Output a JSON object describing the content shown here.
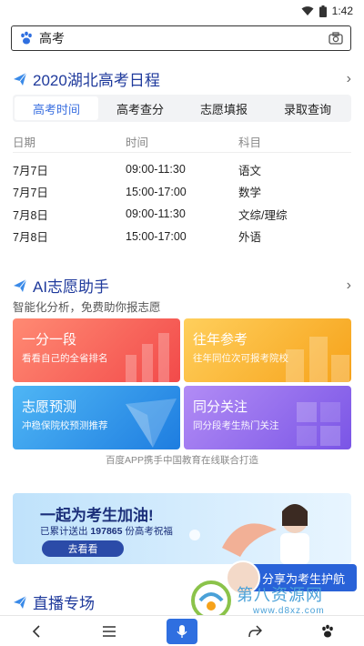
{
  "status": {
    "time": "1:42"
  },
  "search": {
    "query": "高考"
  },
  "schedule_section": {
    "title": "2020湖北高考日程",
    "tabs": [
      "高考时间",
      "高考查分",
      "志愿填报",
      "录取查询"
    ],
    "active_tab": 0,
    "headers": [
      "日期",
      "时间",
      "科目"
    ],
    "rows": [
      [
        "7月7日",
        "09:00-11:30",
        "语文"
      ],
      [
        "7月7日",
        "15:00-17:00",
        "数学"
      ],
      [
        "7月8日",
        "09:00-11:30",
        "文综/理综"
      ],
      [
        "7月8日",
        "15:00-17:00",
        "外语"
      ]
    ]
  },
  "ai_section": {
    "title": "AI志愿助手",
    "subtitle": "智能化分析，免费助你报志愿",
    "cards": [
      {
        "title": "一分一段",
        "sub": "看看自己的全省排名"
      },
      {
        "title": "往年参考",
        "sub": "往年同位次可报考院校"
      },
      {
        "title": "志愿预测",
        "sub": "冲稳保院校预测推荐"
      },
      {
        "title": "同分关注",
        "sub": "同分段考生热门关注"
      }
    ],
    "footnote": "百度APP携手中国教育在线联合打造"
  },
  "banner": {
    "title": "一起为考生加油!",
    "sub_prefix": "已累计送出",
    "count": "197865",
    "sub_suffix": "份高考祝福",
    "button": "去看看"
  },
  "live_section": {
    "title": "直播专场"
  },
  "share_chip": {
    "label": "分享为考生护航"
  },
  "watermark": {
    "name": "第八资源网",
    "url": "www.d8xz.com"
  },
  "colors": {
    "accent": "#2f6fe0",
    "title": "#1f3a9c"
  }
}
